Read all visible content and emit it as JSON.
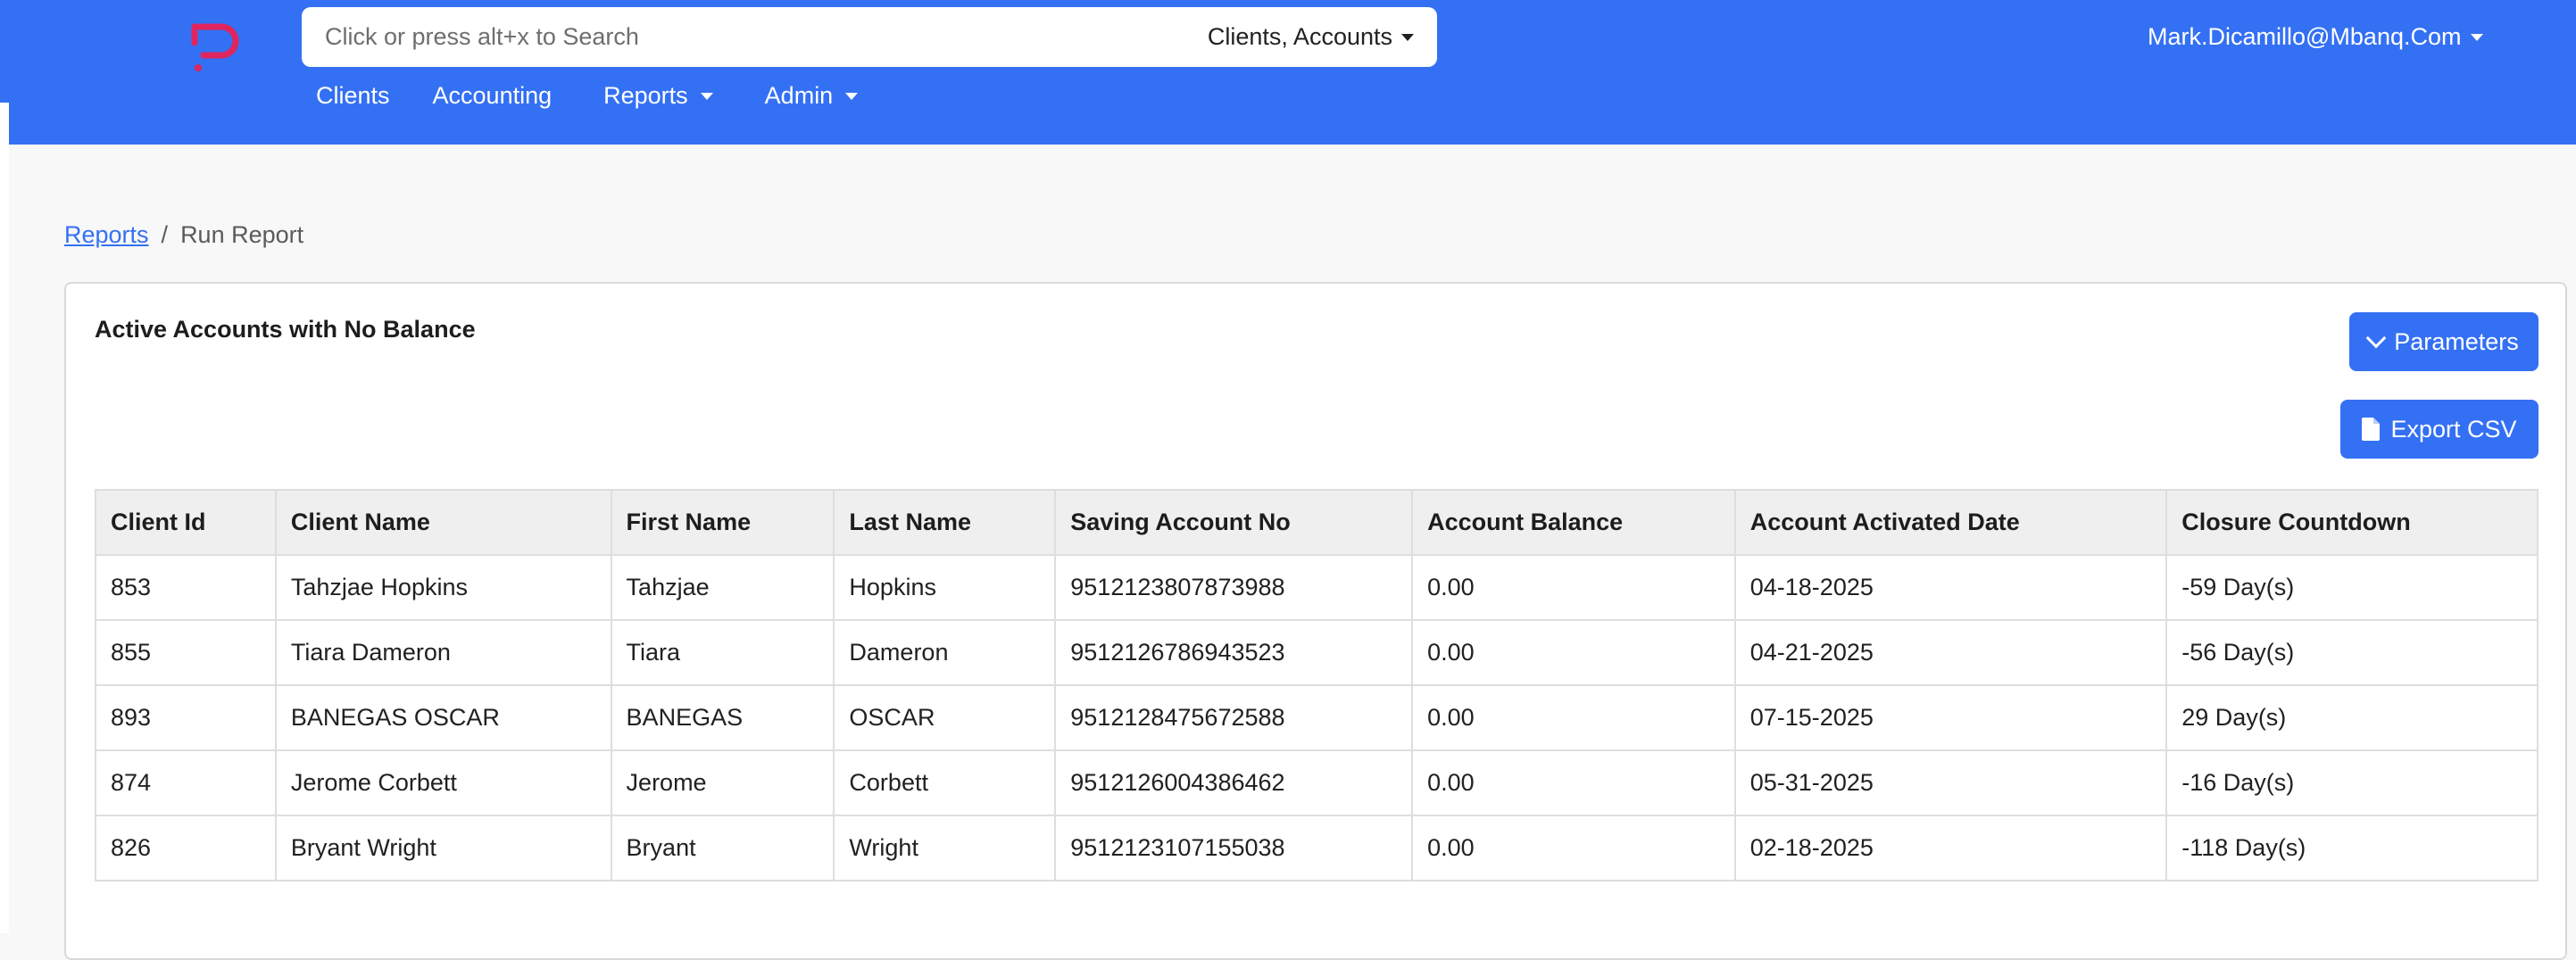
{
  "header": {
    "search_placeholder": "Click or press alt+x to Search",
    "search_scope": "Clients, Accounts",
    "user": "Mark.Dicamillo@Mbanq.Com",
    "nav": {
      "clients": "Clients",
      "accounting": "Accounting",
      "reports": "Reports",
      "admin": "Admin"
    },
    "brand_color": "#3470f3",
    "logo_color": "#e0245e"
  },
  "breadcrumb": {
    "parent": "Reports",
    "separator": "/",
    "current": "Run Report"
  },
  "report": {
    "title": "Active Accounts with No Balance",
    "parameters_label": "Parameters",
    "export_label": "Export CSV",
    "columns": [
      "Client Id",
      "Client Name",
      "First Name",
      "Last Name",
      "Saving Account No",
      "Account Balance",
      "Account Activated Date",
      "Closure Countdown"
    ],
    "rows": [
      [
        "853",
        "Tahzjae Hopkins",
        "Tahzjae",
        "Hopkins",
        "9512123807873988",
        "0.00",
        "04-18-2025",
        "-59 Day(s)"
      ],
      [
        "855",
        "Tiara Dameron",
        "Tiara",
        "Dameron",
        "9512126786943523",
        "0.00",
        "04-21-2025",
        "-56 Day(s)"
      ],
      [
        "893",
        "BANEGAS OSCAR",
        "BANEGAS",
        "OSCAR",
        "9512128475672588",
        "0.00",
        "07-15-2025",
        "29 Day(s)"
      ],
      [
        "874",
        "Jerome Corbett",
        "Jerome",
        "Corbett",
        "9512126004386462",
        "0.00",
        "05-31-2025",
        "-16 Day(s)"
      ],
      [
        "826",
        "Bryant Wright",
        "Bryant",
        "Wright",
        "9512123107155038",
        "0.00",
        "02-18-2025",
        "-118 Day(s)"
      ]
    ]
  }
}
